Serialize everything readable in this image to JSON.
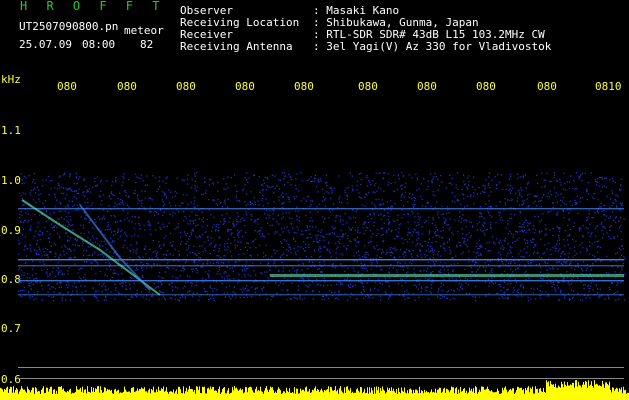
{
  "app": {
    "name": "H R O F F T",
    "file_name": "UT2507090800.pn",
    "mode": "meteor",
    "date": "25.07.09",
    "time": "08:00",
    "count": "82"
  },
  "info": [
    {
      "label": "Observer",
      "value": ": Masaki Kano"
    },
    {
      "label": "Receiving Location",
      "value": ": Shibukawa, Gunma, Japan"
    },
    {
      "label": "Receiver",
      "value": ": RTL-SDR SDR# 43dB L15 103.2MHz CW"
    },
    {
      "label": "Receiving Antenna",
      "value": ": 3el Yagi(V) Az 330 for Vladivostok"
    }
  ],
  "axis": {
    "unit": "kHz",
    "y_ticks": [
      "1.1",
      "1.0",
      "0.9",
      "0.8",
      "0.7",
      "0.6"
    ],
    "x_ticks": [
      "080",
      "080",
      "080",
      "080",
      "080",
      "080",
      "080",
      "080",
      "080",
      "0810"
    ]
  },
  "colors": {
    "header_text": "#ffffff",
    "axis_text": "#ffff33",
    "title_text": "#22cc22",
    "noise": "#2244ff",
    "line": "#4488ff",
    "bright": "#66ffcc",
    "level_bar": "#ffff00"
  }
}
